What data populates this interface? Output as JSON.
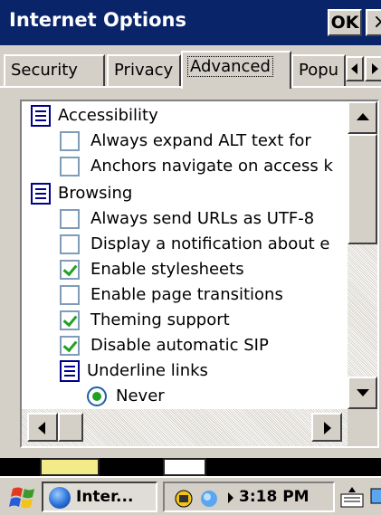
{
  "window": {
    "title": "Internet Options",
    "ok_label": "OK",
    "close_label": "×"
  },
  "tabs": [
    {
      "label": "Security"
    },
    {
      "label": "Privacy"
    },
    {
      "label": "Advanced"
    },
    {
      "label": "Popu"
    }
  ],
  "settings": {
    "accessibility": {
      "label": "Accessibility",
      "items": [
        {
          "label": "Always expand ALT text for",
          "checked": false
        },
        {
          "label": "Anchors navigate on access k",
          "checked": false
        }
      ]
    },
    "browsing": {
      "label": "Browsing",
      "items": [
        {
          "label": "Always send URLs as UTF-8",
          "checked": false
        },
        {
          "label": "Display a notification about e",
          "checked": false
        },
        {
          "label": "Enable stylesheets",
          "checked": true
        },
        {
          "label": "Enable page transitions",
          "checked": false
        },
        {
          "label": "Theming support",
          "checked": true
        },
        {
          "label": "Disable automatic SIP",
          "checked": true
        }
      ],
      "underline": {
        "label": "Underline links",
        "options": [
          {
            "label": "Never",
            "selected": true
          }
        ]
      }
    }
  },
  "taskbar": {
    "task_label": "Inter...",
    "clock": "3:18 PM"
  },
  "colors": {
    "titlebar": "#0a246a",
    "check": "#21a121",
    "window_bg": "#d4d0c8"
  }
}
